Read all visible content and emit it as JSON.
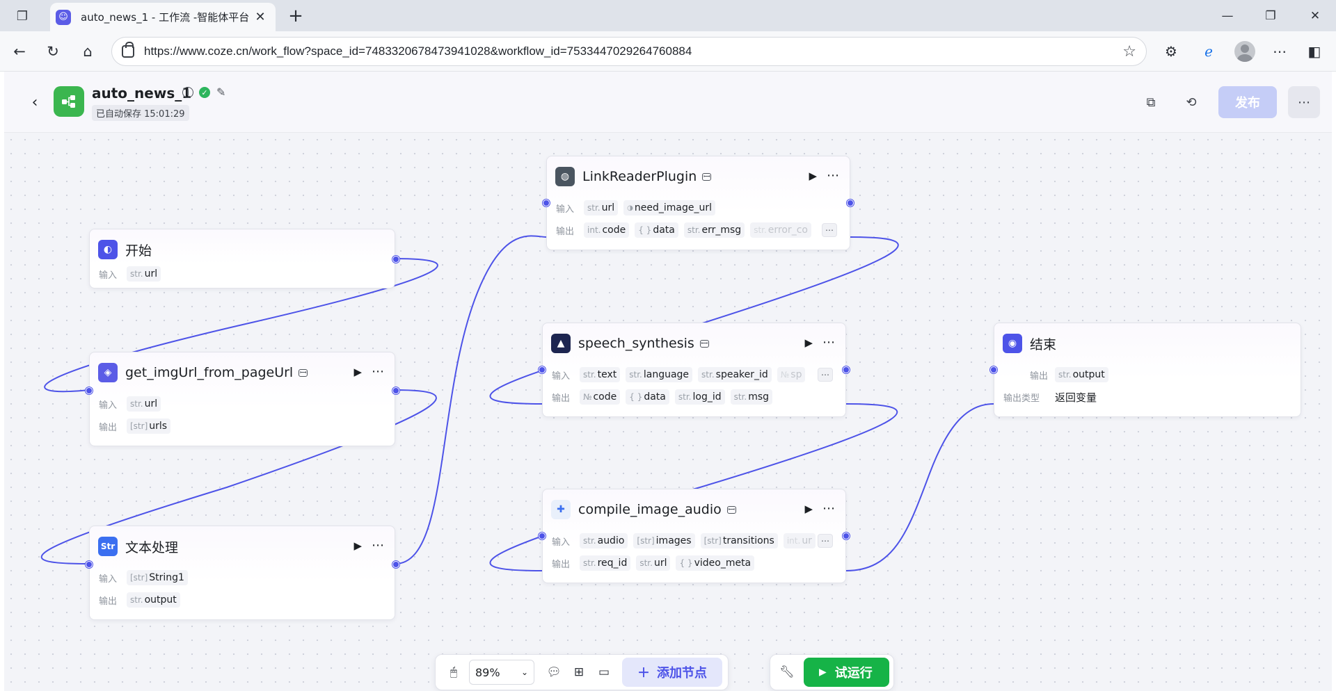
{
  "browser": {
    "tab_title": "auto_news_1 - 工作流 -智能体平台",
    "url": "https://www.coze.cn/work_flow?space_id=7483320678473941028&workflow_id=7533447029264760884"
  },
  "header": {
    "title": "auto_news_1",
    "autosave": "已自动保存 15:01:29",
    "publish_label": "发布"
  },
  "nodes": {
    "start": {
      "title": "开始",
      "input_label": "输入",
      "inputs": [
        {
          "type": "str.",
          "name": "url"
        }
      ]
    },
    "get_img": {
      "title": "get_imgUrl_from_pageUrl",
      "input_label": "输入",
      "output_label": "输出",
      "inputs": [
        {
          "type": "str.",
          "name": "url"
        }
      ],
      "outputs": [
        {
          "type": "[str]",
          "name": "urls"
        }
      ]
    },
    "text_proc": {
      "title": "文本处理",
      "input_label": "输入",
      "output_label": "输出",
      "inputs": [
        {
          "type": "[str]",
          "name": "String1"
        }
      ],
      "outputs": [
        {
          "type": "str.",
          "name": "output"
        }
      ]
    },
    "link_reader": {
      "title": "LinkReaderPlugin",
      "input_label": "输入",
      "output_label": "输出",
      "inputs": [
        {
          "type": "str.",
          "name": "url"
        },
        {
          "type": "bool",
          "name": "need_image_url"
        }
      ],
      "outputs": [
        {
          "type": "int.",
          "name": "code"
        },
        {
          "type": "{ }",
          "name": "data"
        },
        {
          "type": "str.",
          "name": "err_msg"
        },
        {
          "type": "str.",
          "name": "error_co"
        }
      ]
    },
    "speech": {
      "title": "speech_synthesis",
      "input_label": "输入",
      "output_label": "输出",
      "inputs": [
        {
          "type": "str.",
          "name": "text"
        },
        {
          "type": "str.",
          "name": "language"
        },
        {
          "type": "str.",
          "name": "speaker_id"
        },
        {
          "type": "№",
          "name": "sp"
        }
      ],
      "outputs": [
        {
          "type": "№",
          "name": "code"
        },
        {
          "type": "{ }",
          "name": "data"
        },
        {
          "type": "str.",
          "name": "log_id"
        },
        {
          "type": "str.",
          "name": "msg"
        }
      ]
    },
    "compile": {
      "title": "compile_image_audio",
      "input_label": "输入",
      "output_label": "输出",
      "inputs": [
        {
          "type": "str.",
          "name": "audio"
        },
        {
          "type": "[str]",
          "name": "images"
        },
        {
          "type": "[str]",
          "name": "transitions"
        },
        {
          "type": "int.",
          "name": "ur"
        }
      ],
      "outputs": [
        {
          "type": "str.",
          "name": "req_id"
        },
        {
          "type": "str.",
          "name": "url"
        },
        {
          "type": "{ }",
          "name": "video_meta"
        }
      ]
    },
    "end": {
      "title": "结束",
      "output_label": "输出",
      "output_type_label": "输出类型",
      "outputs": [
        {
          "type": "str.",
          "name": "output"
        }
      ],
      "output_type": "返回变量"
    }
  },
  "toolbar": {
    "zoom": "89%",
    "add_node_label": "添加节点",
    "run_label": "试运行"
  },
  "colors": {
    "accent": "#4d53e8",
    "run_green": "#16b347",
    "workflow_icon": "#3bb64f"
  }
}
